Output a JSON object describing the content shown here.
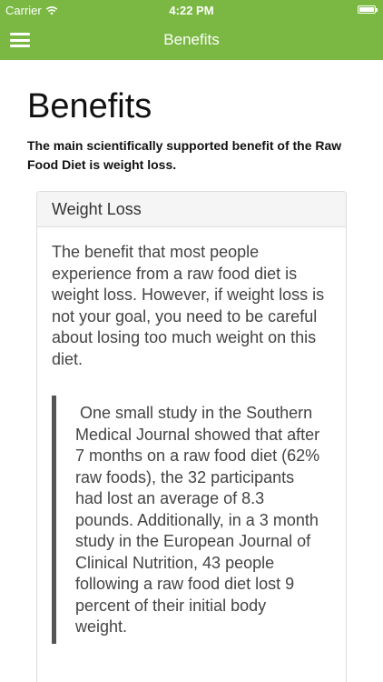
{
  "status_bar": {
    "carrier": "Carrier",
    "wifi_icon": "wifi-icon",
    "time": "4:22 PM",
    "battery_icon": "battery-icon"
  },
  "nav_bar": {
    "menu_icon": "hamburger-icon",
    "title": "Benefits",
    "background_color": "#7ab843"
  },
  "main": {
    "title": "Benefits",
    "lead": "The main scientifically supported benefit of the Raw Food Diet is weight loss.",
    "panel": {
      "heading": "Weight Loss",
      "body": "The benefit that most people experience from a raw food diet is weight loss. However, if weight loss is not your goal, you need to be careful about losing too much weight on this diet.",
      "quote": " One small study in the Southern Medical Journal showed that after 7 months on a raw food diet (62% raw foods), the 32 participants had lost an average of 8.3 pounds. Additionally, in a 3 month study in the European Journal of Clinical Nutrition, 43 people following a raw food diet lost 9 percent of their initial body weight."
    }
  }
}
